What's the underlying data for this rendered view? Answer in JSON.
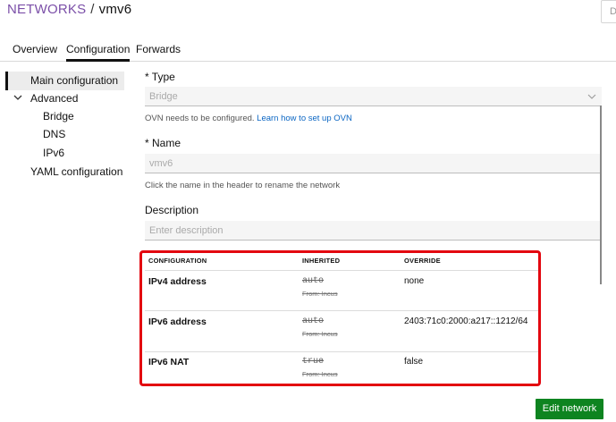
{
  "header": {
    "breadcrumb_root": "NETWORKS",
    "breadcrumb_separator": "/",
    "breadcrumb_current": "vmv6",
    "top_right_button_label": "D"
  },
  "tabs": [
    {
      "label": "Overview",
      "active": false
    },
    {
      "label": "Configuration",
      "active": true
    },
    {
      "label": "Forwards",
      "active": false
    }
  ],
  "sidebar": {
    "items": [
      {
        "label": "Main configuration",
        "active": true
      },
      {
        "label": "Advanced",
        "expanded": true
      },
      {
        "label": "Bridge"
      },
      {
        "label": "DNS"
      },
      {
        "label": "IPv6"
      },
      {
        "label": "YAML configuration"
      }
    ]
  },
  "form": {
    "type_label": "* Type",
    "type_value": "Bridge",
    "ovn_help_text": "OVN needs to be configured.",
    "ovn_help_link": "Learn how to set up OVN",
    "name_label": "* Name",
    "name_value": "vmv6",
    "name_help_text": "Click the name in the header to rename the network",
    "description_label": "Description",
    "description_placeholder": "Enter description"
  },
  "config_table": {
    "headers": [
      "CONFIGURATION",
      "INHERITED",
      "OVERRIDE"
    ],
    "rows": [
      {
        "key": "IPv4 address",
        "inherited": "auto",
        "inherited_from": "From: Incus",
        "override": "none"
      },
      {
        "key": "IPv6 address",
        "inherited": "auto",
        "inherited_from": "From: Incus",
        "override": "2403:71c0:2000:a217::1212/64"
      },
      {
        "key": "IPv6 NAT",
        "inherited": "true",
        "inherited_from": "From: Incus",
        "override": "false"
      }
    ]
  },
  "actions": {
    "edit_label": "Edit network"
  },
  "colors": {
    "accent": "#7b4fa8",
    "primary_button": "#0e8420",
    "highlight": "#e3060f",
    "link": "#0b66c3"
  }
}
